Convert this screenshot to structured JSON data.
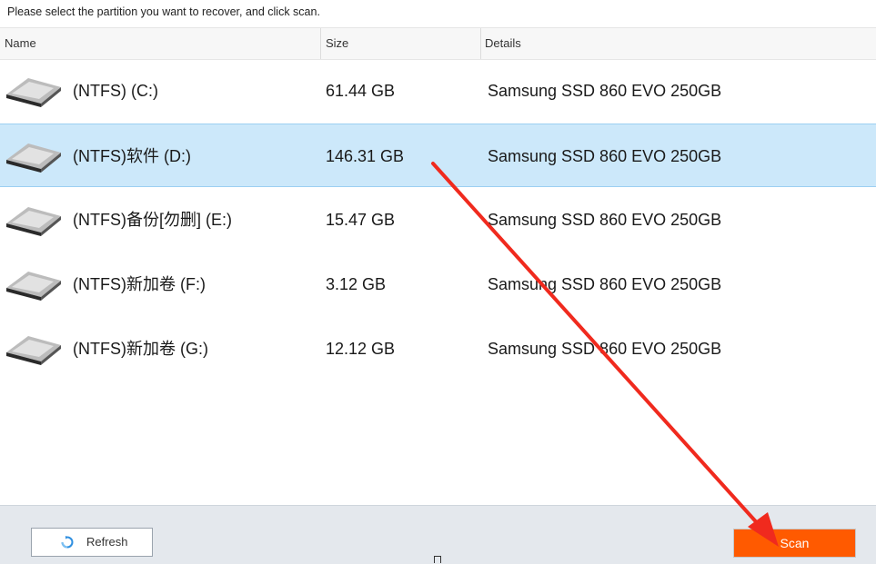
{
  "instruction": "Please select the partition you want to recover, and click scan.",
  "columns": {
    "name": "Name",
    "size": "Size",
    "details": "Details"
  },
  "partitions": [
    {
      "name": "(NTFS) (C:)",
      "size": "61.44 GB",
      "details": "Samsung SSD 860 EVO 250GB",
      "selected": false
    },
    {
      "name": "(NTFS)软件 (D:)",
      "size": "146.31 GB",
      "details": "Samsung SSD 860 EVO 250GB",
      "selected": true
    },
    {
      "name": "(NTFS)备份[勿删] (E:)",
      "size": "15.47 GB",
      "details": "Samsung SSD 860 EVO 250GB",
      "selected": false
    },
    {
      "name": "(NTFS)新加卷 (F:)",
      "size": "3.12 GB",
      "details": "Samsung SSD 860 EVO 250GB",
      "selected": false
    },
    {
      "name": "(NTFS)新加卷 (G:)",
      "size": "12.12 GB",
      "details": "Samsung SSD 860 EVO 250GB",
      "selected": false
    }
  ],
  "footer": {
    "refresh_label": "Refresh",
    "scan_label": "Scan"
  },
  "icons": {
    "drive": "hard-drive-icon",
    "refresh": "refresh-icon"
  },
  "colors": {
    "selected_row": "#cce8fa",
    "scan_button": "#ff5a00",
    "annotation_arrow": "#f02a1e",
    "refresh_icon": "#2f8fe0"
  }
}
